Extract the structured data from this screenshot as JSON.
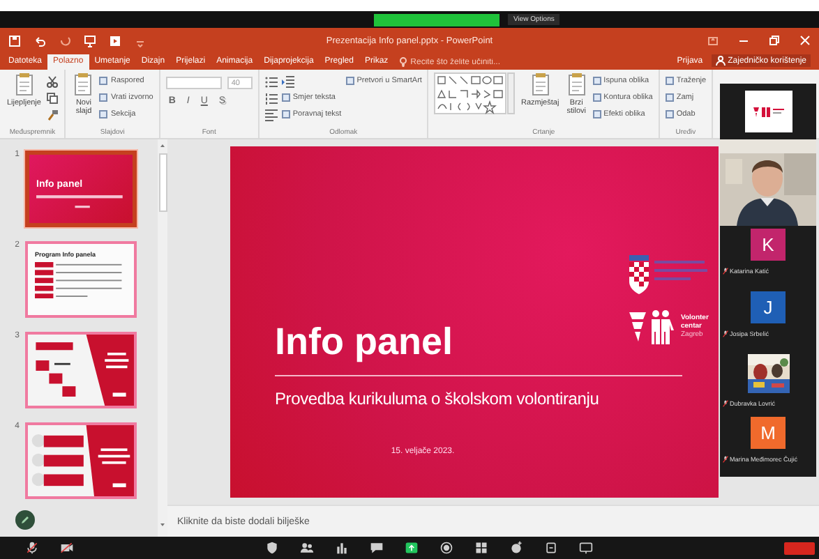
{
  "zoom_bar": {
    "options": "View Options"
  },
  "window": {
    "title": "Prezentacija Info panel.pptx - PowerPoint"
  },
  "tabs": [
    {
      "label": "Datoteka",
      "selected": false
    },
    {
      "label": "Polazno",
      "selected": true
    },
    {
      "label": "Umetanje",
      "selected": false
    },
    {
      "label": "Dizajn",
      "selected": false
    },
    {
      "label": "Prijelazi",
      "selected": false
    },
    {
      "label": "Animacija",
      "selected": false
    },
    {
      "label": "Dijaprojekcija",
      "selected": false
    },
    {
      "label": "Pregled",
      "selected": false
    },
    {
      "label": "Prikaz",
      "selected": false
    }
  ],
  "tell_me": {
    "placeholder": "Recite što želite učiniti..."
  },
  "account": {
    "sign_in": "Prijava",
    "share": "Zajedničko korištenje"
  },
  "ribbon": {
    "groups": [
      {
        "label": "Međuspremnik",
        "items": [
          {
            "kind": "large",
            "label": "Lijepljenje"
          },
          {
            "kind": "cut"
          },
          {
            "kind": "copy"
          },
          {
            "kind": "brush"
          }
        ]
      },
      {
        "label": "Slajdovi",
        "items": [
          {
            "kind": "large",
            "label": "Novi slajd"
          },
          {
            "kind": "small",
            "label": "Raspored"
          },
          {
            "kind": "small",
            "label": "Vrati izvorno"
          },
          {
            "kind": "small",
            "label": "Sekcija"
          }
        ]
      },
      {
        "label": "Font",
        "rows": [
          [
            {
              "kind": "font-field"
            },
            {
              "kind": "size-field",
              "value": "40"
            }
          ],
          [
            {
              "kind": "bold",
              "label": "B"
            },
            {
              "kind": "italic",
              "label": "I"
            },
            {
              "kind": "underline",
              "label": "U"
            },
            {
              "kind": "shadow",
              "label": "S"
            }
          ]
        ]
      },
      {
        "label": "Odlomak",
        "items": [
          {
            "kind": "bullets"
          },
          {
            "kind": "numbers"
          },
          {
            "kind": "align"
          },
          {
            "kind": "indent"
          },
          {
            "kind": "small",
            "label": "Smjer teksta"
          },
          {
            "kind": "small",
            "label": "Poravnaj tekst"
          },
          {
            "kind": "small",
            "label": "Pretvori u SmartArt"
          }
        ]
      },
      {
        "label": "Crtanje",
        "items": [
          {
            "kind": "gallery"
          },
          {
            "kind": "large",
            "label": "Razmještaj"
          },
          {
            "kind": "large",
            "label": "Brzi stilovi"
          },
          {
            "kind": "small",
            "label": "Ispuna oblika"
          },
          {
            "kind": "small",
            "label": "Kontura oblika"
          },
          {
            "kind": "small",
            "label": "Efekti oblika"
          }
        ]
      },
      {
        "label": "Uređiv",
        "items": [
          {
            "kind": "small",
            "label": "Traženje"
          },
          {
            "kind": "small",
            "label": "Zamj"
          },
          {
            "kind": "small",
            "label": "Odab"
          }
        ]
      }
    ]
  },
  "thumbnails": [
    {
      "number": "1",
      "selected": true,
      "kind": "title",
      "title": "Info panel"
    },
    {
      "number": "2",
      "selected": false,
      "kind": "agenda",
      "title": "Program Info panela"
    },
    {
      "number": "3",
      "selected": false,
      "kind": "project"
    },
    {
      "number": "4",
      "selected": false,
      "kind": "list"
    }
  ],
  "slide": {
    "title": "Info panel",
    "subtitle": "Provedba kurikuluma o školskom volontiranju",
    "date": "15. veljače 2023.",
    "logo_text": [
      "Volonter",
      "centar",
      "Zagreb"
    ]
  },
  "notes": {
    "placeholder": "Kliknite da biste dodali bilješke"
  },
  "participants": [
    {
      "kind": "screen"
    },
    {
      "kind": "video"
    },
    {
      "kind": "avatar",
      "initial": "K",
      "name": "Katarina Katić",
      "color": "#c2256c",
      "muted": true
    },
    {
      "kind": "avatar",
      "initial": "J",
      "name": "Josipa Srbelić",
      "color": "#1f5fb5",
      "muted": true
    },
    {
      "name": "Dubravka Lovrić",
      "muted": true
    },
    {
      "kind": "avatar",
      "initial": "M",
      "name": "Marina Međimorec Čujić",
      "color": "#f06a2c",
      "muted": true
    }
  ],
  "meeting_toolbar": [
    {
      "kind": "mic"
    },
    {
      "kind": "camera"
    },
    {
      "kind": "spacer"
    },
    {
      "kind": "shield"
    },
    {
      "kind": "people"
    },
    {
      "kind": "polls"
    },
    {
      "kind": "chat"
    },
    {
      "kind": "share"
    },
    {
      "kind": "record"
    },
    {
      "kind": "rooms"
    },
    {
      "kind": "reactions"
    },
    {
      "kind": "apps"
    },
    {
      "kind": "whiteboard"
    },
    {
      "kind": "spacer"
    },
    {
      "kind": "leave"
    }
  ]
}
